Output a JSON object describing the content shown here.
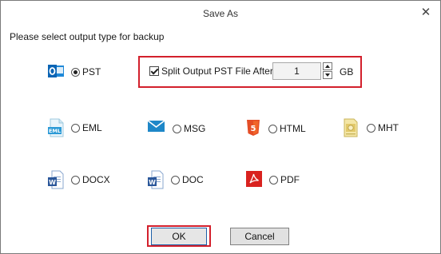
{
  "dialog": {
    "title": "Save As",
    "instruction": "Please select output type for backup"
  },
  "options": {
    "pst": {
      "label": "PST",
      "icon": "outlook-icon",
      "selected": true
    },
    "eml": {
      "label": "EML",
      "icon": "eml-file-icon",
      "icon_text": "EML"
    },
    "msg": {
      "label": "MSG",
      "icon": "envelope-icon"
    },
    "html": {
      "label": "HTML",
      "icon": "html5-icon",
      "icon_text": "5"
    },
    "mht": {
      "label": "MHT",
      "icon": "mht-file-icon"
    },
    "docx": {
      "label": "DOCX",
      "icon": "word-doc-icon",
      "icon_text": "W"
    },
    "doc": {
      "label": "DOC",
      "icon": "word-doc-icon",
      "icon_text": "W"
    },
    "pdf": {
      "label": "PDF",
      "icon": "pdf-icon"
    }
  },
  "split": {
    "checked": true,
    "label": "Split Output PST File After:",
    "value": "1",
    "unit": "GB"
  },
  "buttons": {
    "ok": "OK",
    "cancel": "Cancel"
  },
  "colors": {
    "highlight_frame": "#d3202c",
    "outlook_blue": "#0a64b4",
    "html5_orange": "#e44d26",
    "pdf_red": "#d9221f",
    "word_blue": "#2b579a"
  }
}
